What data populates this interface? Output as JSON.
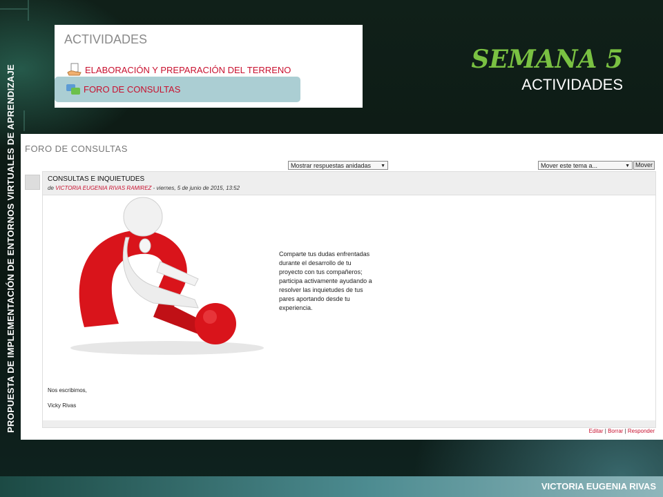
{
  "colors": {
    "accent_green": "#7ac142",
    "link_red": "#c8102e",
    "selected_bg": "#abced3"
  },
  "side_banner": "PROPUESTA DE IMPLEMENTACIÓN DE ENTORNOS VIRTUALES DE APRENDIZAJE",
  "heading": {
    "title": "SEMANA 5",
    "subtitle": "ACTIVIDADES"
  },
  "activities": {
    "title": "ACTIVIDADES",
    "items": [
      {
        "label": "ELABORACIÓN Y PREPARACIÓN DEL TERRENO",
        "icon": "hand-document-icon"
      },
      {
        "label": "FORO DE CONSULTAS",
        "icon": "forum-chat-icon",
        "selected": true
      }
    ]
  },
  "forum": {
    "title": "FORO DE CONSULTAS",
    "display_select": "Mostrar respuestas anidadas",
    "move_select": "Mover este tema a...",
    "move_button": "Mover",
    "post": {
      "subject": "CONSULTAS E INQUIETUDES",
      "by_prefix": "de",
      "author": "VICTORIA EUGENIA RIVAS RAMIREZ",
      "date": " - viernes, 5 de junio de 2015, 13:52",
      "message": "Comparte tus dudas enfrentadas durante el desarrollo de tu proyecto con tus compañeros; participa activamente ayudando a resolver las inquietudes de tus pares aportando desde tu experiencia.",
      "closing": "Nos escribimos,",
      "signature": "Vicky Rivas",
      "image_icon": "thinking-figure-question-mark-icon"
    },
    "actions": {
      "edit": "Editar",
      "delete": "Borrar",
      "reply": "Responder",
      "separator": "|"
    }
  },
  "footer_author": "VICTORIA EUGENIA RIVAS"
}
